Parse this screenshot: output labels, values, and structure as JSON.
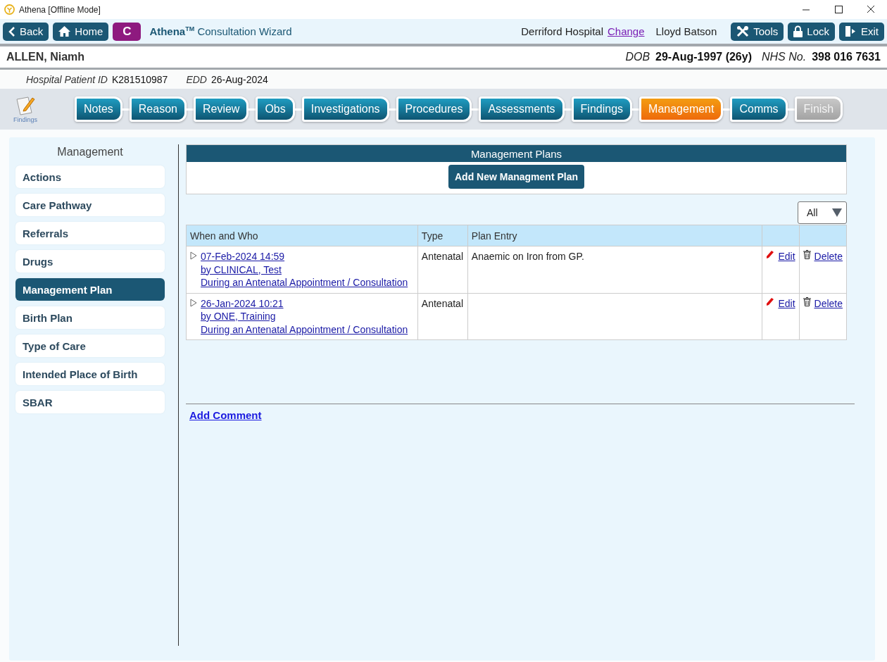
{
  "window": {
    "title": "Athena [Offline Mode]"
  },
  "toolbar": {
    "buttons": [
      {
        "label": "Back",
        "kind": "back"
      },
      {
        "label": "Home",
        "kind": "home"
      }
    ],
    "context_badge": "C",
    "app_name": "Athena",
    "trademark": "TM",
    "app_subtitle": "Consultation Wizard",
    "hospital": "Derriford Hospital",
    "change_link": "Change",
    "user": "Lloyd Batson",
    "actions": [
      {
        "label": "Tools",
        "kind": "tools"
      },
      {
        "label": "Lock",
        "kind": "lock"
      },
      {
        "label": "Exit",
        "kind": "exit"
      }
    ]
  },
  "patient": {
    "name": "ALLEN, Niamh",
    "dob_label": "DOB",
    "dob": "29-Aug-1997 (26y)",
    "nhs_label": "NHS No.",
    "nhs": "398 016 7631",
    "id_label": "Hospital Patient ID",
    "id": "K281510987",
    "edd_label": "EDD",
    "edd": "26-Aug-2024"
  },
  "current_section": {
    "icon_label": "Findings"
  },
  "steps": [
    {
      "label": "Notes",
      "selected": false,
      "disabled": false
    },
    {
      "label": "Reason",
      "selected": false,
      "disabled": false
    },
    {
      "label": "Review",
      "selected": false,
      "disabled": false
    },
    {
      "label": "Obs",
      "selected": false,
      "disabled": false
    },
    {
      "label": "Investigations",
      "selected": false,
      "disabled": false
    },
    {
      "label": "Procedures",
      "selected": false,
      "disabled": false
    },
    {
      "label": "Assessments",
      "selected": false,
      "disabled": false
    },
    {
      "label": "Findings",
      "selected": false,
      "disabled": false
    },
    {
      "label": "Management",
      "selected": true,
      "disabled": false
    },
    {
      "label": "Comms",
      "selected": false,
      "disabled": false
    },
    {
      "label": "Finish",
      "selected": false,
      "disabled": true
    }
  ],
  "sidebar": {
    "title": "Management",
    "items": [
      {
        "label": "Actions",
        "selected": false
      },
      {
        "label": "Care Pathway",
        "selected": false
      },
      {
        "label": "Referrals",
        "selected": false
      },
      {
        "label": "Drugs",
        "selected": false
      },
      {
        "label": "Management Plan",
        "selected": true
      },
      {
        "label": "Birth Plan",
        "selected": false
      },
      {
        "label": "Type of Care",
        "selected": false
      },
      {
        "label": "Intended Place of Birth",
        "selected": false
      },
      {
        "label": "SBAR",
        "selected": false
      }
    ]
  },
  "plans": {
    "title": "Management Plans",
    "add_button": "Add New Managment Plan",
    "filter": "All",
    "columns": [
      "When and Who",
      "Type",
      "Plan Entry"
    ],
    "rows": [
      {
        "when": "07-Feb-2024 14:59",
        "who": "by CLINICAL, Test",
        "context": "During an Antenatal Appointment / Consultation",
        "type": "Antenatal",
        "entry": "Anaemic on Iron from GP.",
        "edit": "Edit",
        "delete": "Delete"
      },
      {
        "when": "26-Jan-2024 10:21",
        "who": "by ONE, Training",
        "context": "During an Antenatal Appointment / Consultation",
        "type": "Antenatal",
        "edit": "Edit",
        "delete": "Delete"
      }
    ],
    "comment_link": "Add Comment"
  }
}
